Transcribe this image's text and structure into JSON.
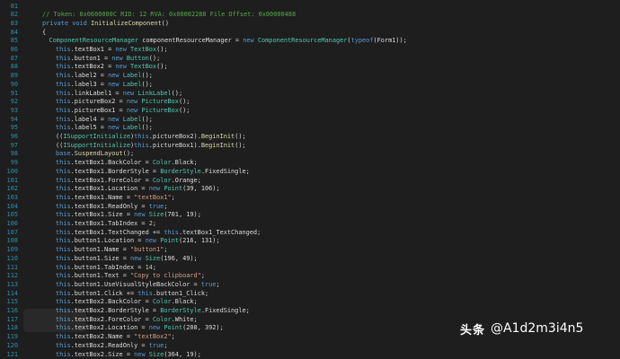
{
  "editor": {
    "colors": {
      "background": "#1e1e1e",
      "line_number": "#2b91af",
      "default": "#dcdcdc",
      "keyword": "#569cd6",
      "type": "#4ec9b0",
      "string": "#d69d85",
      "number": "#b5cea8",
      "comment": "#57a64a",
      "member": "#dcdcaa"
    },
    "lines": [
      {
        "n": "81",
        "indent": 0,
        "tokens": []
      },
      {
        "n": "82",
        "indent": 2,
        "tokens": [
          {
            "t": "// Token: 0x0600000C RID: 12 RVA: 0x00002288 File Offset: 0x00000488",
            "c": "comment"
          }
        ]
      },
      {
        "n": "83",
        "indent": 2,
        "tokens": [
          {
            "t": "private ",
            "c": "keyword"
          },
          {
            "t": "void ",
            "c": "keyword"
          },
          {
            "t": "InitializeComponent",
            "c": "member"
          },
          {
            "t": "()",
            "c": "default"
          }
        ]
      },
      {
        "n": "84",
        "indent": 2,
        "tokens": [
          {
            "t": "{",
            "c": "default"
          }
        ]
      },
      {
        "n": "85",
        "indent": 3,
        "tokens": [
          {
            "t": "ComponentResourceManager ",
            "c": "type"
          },
          {
            "t": "componentResourceManager = ",
            "c": "default"
          },
          {
            "t": "new ",
            "c": "keyword"
          },
          {
            "t": "ComponentResourceManager",
            "c": "type"
          },
          {
            "t": "(",
            "c": "default"
          },
          {
            "t": "typeof",
            "c": "keyword"
          },
          {
            "t": "(Form1));",
            "c": "default"
          }
        ]
      },
      {
        "n": "86",
        "indent": 4,
        "tokens": [
          {
            "t": "this",
            "c": "keyword"
          },
          {
            "t": ".textBox1 = ",
            "c": "default"
          },
          {
            "t": "new ",
            "c": "keyword"
          },
          {
            "t": "TextBox",
            "c": "type"
          },
          {
            "t": "();",
            "c": "default"
          }
        ]
      },
      {
        "n": "87",
        "indent": 4,
        "tokens": [
          {
            "t": "this",
            "c": "keyword"
          },
          {
            "t": ".button1 = ",
            "c": "default"
          },
          {
            "t": "new ",
            "c": "keyword"
          },
          {
            "t": "Button",
            "c": "type"
          },
          {
            "t": "();",
            "c": "default"
          }
        ]
      },
      {
        "n": "88",
        "indent": 4,
        "tokens": [
          {
            "t": "this",
            "c": "keyword"
          },
          {
            "t": ".textBox2 = ",
            "c": "default"
          },
          {
            "t": "new ",
            "c": "keyword"
          },
          {
            "t": "TextBox",
            "c": "type"
          },
          {
            "t": "();",
            "c": "default"
          }
        ]
      },
      {
        "n": "89",
        "indent": 4,
        "tokens": [
          {
            "t": "this",
            "c": "keyword"
          },
          {
            "t": ".label2 = ",
            "c": "default"
          },
          {
            "t": "new ",
            "c": "keyword"
          },
          {
            "t": "Label",
            "c": "type"
          },
          {
            "t": "();",
            "c": "default"
          }
        ]
      },
      {
        "n": "90",
        "indent": 4,
        "tokens": [
          {
            "t": "this",
            "c": "keyword"
          },
          {
            "t": ".label3 = ",
            "c": "default"
          },
          {
            "t": "new ",
            "c": "keyword"
          },
          {
            "t": "Label",
            "c": "type"
          },
          {
            "t": "();",
            "c": "default"
          }
        ]
      },
      {
        "n": "91",
        "indent": 4,
        "tokens": [
          {
            "t": "this",
            "c": "keyword"
          },
          {
            "t": ".linkLabel1 = ",
            "c": "default"
          },
          {
            "t": "new ",
            "c": "keyword"
          },
          {
            "t": "LinkLabel",
            "c": "type"
          },
          {
            "t": "();",
            "c": "default"
          }
        ]
      },
      {
        "n": "92",
        "indent": 4,
        "tokens": [
          {
            "t": "this",
            "c": "keyword"
          },
          {
            "t": ".pictureBox2 = ",
            "c": "default"
          },
          {
            "t": "new ",
            "c": "keyword"
          },
          {
            "t": "PictureBox",
            "c": "type"
          },
          {
            "t": "();",
            "c": "default"
          }
        ]
      },
      {
        "n": "93",
        "indent": 4,
        "tokens": [
          {
            "t": "this",
            "c": "keyword"
          },
          {
            "t": ".pictureBox1 = ",
            "c": "default"
          },
          {
            "t": "new ",
            "c": "keyword"
          },
          {
            "t": "PictureBox",
            "c": "type"
          },
          {
            "t": "();",
            "c": "default"
          }
        ]
      },
      {
        "n": "94",
        "indent": 4,
        "tokens": [
          {
            "t": "this",
            "c": "keyword"
          },
          {
            "t": ".label4 = ",
            "c": "default"
          },
          {
            "t": "new ",
            "c": "keyword"
          },
          {
            "t": "Label",
            "c": "type"
          },
          {
            "t": "();",
            "c": "default"
          }
        ]
      },
      {
        "n": "95",
        "indent": 4,
        "tokens": [
          {
            "t": "this",
            "c": "keyword"
          },
          {
            "t": ".label5 = ",
            "c": "default"
          },
          {
            "t": "new ",
            "c": "keyword"
          },
          {
            "t": "Label",
            "c": "type"
          },
          {
            "t": "();",
            "c": "default"
          }
        ]
      },
      {
        "n": "96",
        "indent": 4,
        "tokens": [
          {
            "t": "((",
            "c": "default"
          },
          {
            "t": "ISupportInitialize",
            "c": "type"
          },
          {
            "t": ")",
            "c": "default"
          },
          {
            "t": "this",
            "c": "keyword"
          },
          {
            "t": ".pictureBox2).",
            "c": "default"
          },
          {
            "t": "BeginInit",
            "c": "member"
          },
          {
            "t": "();",
            "c": "default"
          }
        ]
      },
      {
        "n": "97",
        "indent": 4,
        "tokens": [
          {
            "t": "((",
            "c": "default"
          },
          {
            "t": "ISupportInitialize",
            "c": "type"
          },
          {
            "t": ")",
            "c": "default"
          },
          {
            "t": "this",
            "c": "keyword"
          },
          {
            "t": ".pictureBox1).",
            "c": "default"
          },
          {
            "t": "BeginInit",
            "c": "member"
          },
          {
            "t": "();",
            "c": "default"
          }
        ]
      },
      {
        "n": "98",
        "indent": 4,
        "tokens": [
          {
            "t": "base",
            "c": "keyword"
          },
          {
            "t": ".",
            "c": "default"
          },
          {
            "t": "SuspendLayout",
            "c": "member"
          },
          {
            "t": "();",
            "c": "default"
          }
        ]
      },
      {
        "n": "99",
        "indent": 4,
        "tokens": [
          {
            "t": "this",
            "c": "keyword"
          },
          {
            "t": ".textBox1.BackColor = ",
            "c": "default"
          },
          {
            "t": "Color",
            "c": "type"
          },
          {
            "t": ".Black;",
            "c": "default"
          }
        ]
      },
      {
        "n": "100",
        "indent": 4,
        "tokens": [
          {
            "t": "this",
            "c": "keyword"
          },
          {
            "t": ".textBox1.BorderStyle = ",
            "c": "default"
          },
          {
            "t": "BorderStyle",
            "c": "type"
          },
          {
            "t": ".FixedSingle;",
            "c": "default"
          }
        ]
      },
      {
        "n": "101",
        "indent": 4,
        "tokens": [
          {
            "t": "this",
            "c": "keyword"
          },
          {
            "t": ".textBox1.ForeColor = ",
            "c": "default"
          },
          {
            "t": "Color",
            "c": "type"
          },
          {
            "t": ".Orange;",
            "c": "default"
          }
        ]
      },
      {
        "n": "102",
        "indent": 4,
        "tokens": [
          {
            "t": "this",
            "c": "keyword"
          },
          {
            "t": ".textBox1.Location = ",
            "c": "default"
          },
          {
            "t": "new ",
            "c": "keyword"
          },
          {
            "t": "Point",
            "c": "type"
          },
          {
            "t": "(39, 106);",
            "c": "default"
          }
        ]
      },
      {
        "n": "103",
        "indent": 4,
        "tokens": [
          {
            "t": "this",
            "c": "keyword"
          },
          {
            "t": ".textBox1.Name = ",
            "c": "default"
          },
          {
            "t": "\"textBox1\"",
            "c": "string"
          },
          {
            "t": ";",
            "c": "default"
          }
        ]
      },
      {
        "n": "104",
        "indent": 4,
        "tokens": [
          {
            "t": "this",
            "c": "keyword"
          },
          {
            "t": ".textBox1.ReadOnly = ",
            "c": "default"
          },
          {
            "t": "true",
            "c": "keyword"
          },
          {
            "t": ";",
            "c": "default"
          }
        ]
      },
      {
        "n": "105",
        "indent": 4,
        "tokens": [
          {
            "t": "this",
            "c": "keyword"
          },
          {
            "t": ".textBox1.Size = ",
            "c": "default"
          },
          {
            "t": "new ",
            "c": "keyword"
          },
          {
            "t": "Size",
            "c": "type"
          },
          {
            "t": "(701, 19);",
            "c": "default"
          }
        ]
      },
      {
        "n": "106",
        "indent": 4,
        "tokens": [
          {
            "t": "this",
            "c": "keyword"
          },
          {
            "t": ".textBox1.TabIndex = ",
            "c": "default"
          },
          {
            "t": "2",
            "c": "number"
          },
          {
            "t": ";",
            "c": "default"
          }
        ]
      },
      {
        "n": "107",
        "indent": 4,
        "tokens": [
          {
            "t": "this",
            "c": "keyword"
          },
          {
            "t": ".textBox1.TextChanged += ",
            "c": "default"
          },
          {
            "t": "this",
            "c": "keyword"
          },
          {
            "t": ".textBox1_TextChanged;",
            "c": "default"
          }
        ]
      },
      {
        "n": "108",
        "indent": 4,
        "tokens": [
          {
            "t": "this",
            "c": "keyword"
          },
          {
            "t": ".button1.Location = ",
            "c": "default"
          },
          {
            "t": "new ",
            "c": "keyword"
          },
          {
            "t": "Point",
            "c": "type"
          },
          {
            "t": "(216, 131);",
            "c": "default"
          }
        ]
      },
      {
        "n": "109",
        "indent": 4,
        "tokens": [
          {
            "t": "this",
            "c": "keyword"
          },
          {
            "t": ".button1.Name = ",
            "c": "default"
          },
          {
            "t": "\"button1\"",
            "c": "string"
          },
          {
            "t": ";",
            "c": "default"
          }
        ]
      },
      {
        "n": "110",
        "indent": 4,
        "tokens": [
          {
            "t": "this",
            "c": "keyword"
          },
          {
            "t": ".button1.Size = ",
            "c": "default"
          },
          {
            "t": "new ",
            "c": "keyword"
          },
          {
            "t": "Size",
            "c": "type"
          },
          {
            "t": "(196, 49);",
            "c": "default"
          }
        ]
      },
      {
        "n": "111",
        "indent": 4,
        "tokens": [
          {
            "t": "this",
            "c": "keyword"
          },
          {
            "t": ".button1.TabIndex = ",
            "c": "default"
          },
          {
            "t": "14",
            "c": "number"
          },
          {
            "t": ";",
            "c": "default"
          }
        ]
      },
      {
        "n": "112",
        "indent": 4,
        "tokens": [
          {
            "t": "this",
            "c": "keyword"
          },
          {
            "t": ".button1.Text = ",
            "c": "default"
          },
          {
            "t": "\"Copy to clipboard\"",
            "c": "string"
          },
          {
            "t": ";",
            "c": "default"
          }
        ]
      },
      {
        "n": "113",
        "indent": 4,
        "tokens": [
          {
            "t": "this",
            "c": "keyword"
          },
          {
            "t": ".button1.UseVisualStyleBackColor = ",
            "c": "default"
          },
          {
            "t": "true",
            "c": "keyword"
          },
          {
            "t": ";",
            "c": "default"
          }
        ]
      },
      {
        "n": "114",
        "indent": 4,
        "tokens": [
          {
            "t": "this",
            "c": "keyword"
          },
          {
            "t": ".button1.Click += ",
            "c": "default"
          },
          {
            "t": "this",
            "c": "keyword"
          },
          {
            "t": ".button1_Click;",
            "c": "default"
          }
        ]
      },
      {
        "n": "115",
        "indent": 4,
        "tokens": [
          {
            "t": "this",
            "c": "keyword"
          },
          {
            "t": ".textBox2.BackColor = ",
            "c": "default"
          },
          {
            "t": "Color",
            "c": "type"
          },
          {
            "t": ".Black;",
            "c": "default"
          }
        ]
      },
      {
        "n": "116",
        "indent": 4,
        "tokens": [
          {
            "t": "this",
            "c": "keyword"
          },
          {
            "t": ".textBox2.BorderStyle = ",
            "c": "default"
          },
          {
            "t": "BorderStyle",
            "c": "type"
          },
          {
            "t": ".FixedSingle;",
            "c": "default"
          }
        ]
      },
      {
        "n": "117",
        "indent": 4,
        "tokens": [
          {
            "t": "this",
            "c": "keyword"
          },
          {
            "t": ".textBox2.ForeColor = ",
            "c": "default"
          },
          {
            "t": "Color",
            "c": "type"
          },
          {
            "t": ".White;",
            "c": "default"
          }
        ]
      },
      {
        "n": "118",
        "indent": 4,
        "tokens": [
          {
            "t": "this",
            "c": "keyword"
          },
          {
            "t": ".textBox2.Location = ",
            "c": "default"
          },
          {
            "t": "new ",
            "c": "keyword"
          },
          {
            "t": "Point",
            "c": "type"
          },
          {
            "t": "(208, 392);",
            "c": "default"
          }
        ]
      },
      {
        "n": "119",
        "indent": 4,
        "tokens": [
          {
            "t": "this",
            "c": "keyword"
          },
          {
            "t": ".textBox2.Name = ",
            "c": "default"
          },
          {
            "t": "\"textBox2\"",
            "c": "string"
          },
          {
            "t": ";",
            "c": "default"
          }
        ]
      },
      {
        "n": "120",
        "indent": 4,
        "tokens": [
          {
            "t": "this",
            "c": "keyword"
          },
          {
            "t": ".textBox2.ReadOnly = ",
            "c": "default"
          },
          {
            "t": "true",
            "c": "keyword"
          },
          {
            "t": ";",
            "c": "default"
          }
        ]
      },
      {
        "n": "121",
        "indent": 4,
        "tokens": [
          {
            "t": "this",
            "c": "keyword"
          },
          {
            "t": ".textBox2.Size = ",
            "c": "default"
          },
          {
            "t": "new ",
            "c": "keyword"
          },
          {
            "t": "Size",
            "c": "type"
          },
          {
            "t": "(364, 19);",
            "c": "default"
          }
        ]
      }
    ]
  },
  "watermark": {
    "brand": "头条",
    "handle": "@A1d2m3i4n5"
  }
}
